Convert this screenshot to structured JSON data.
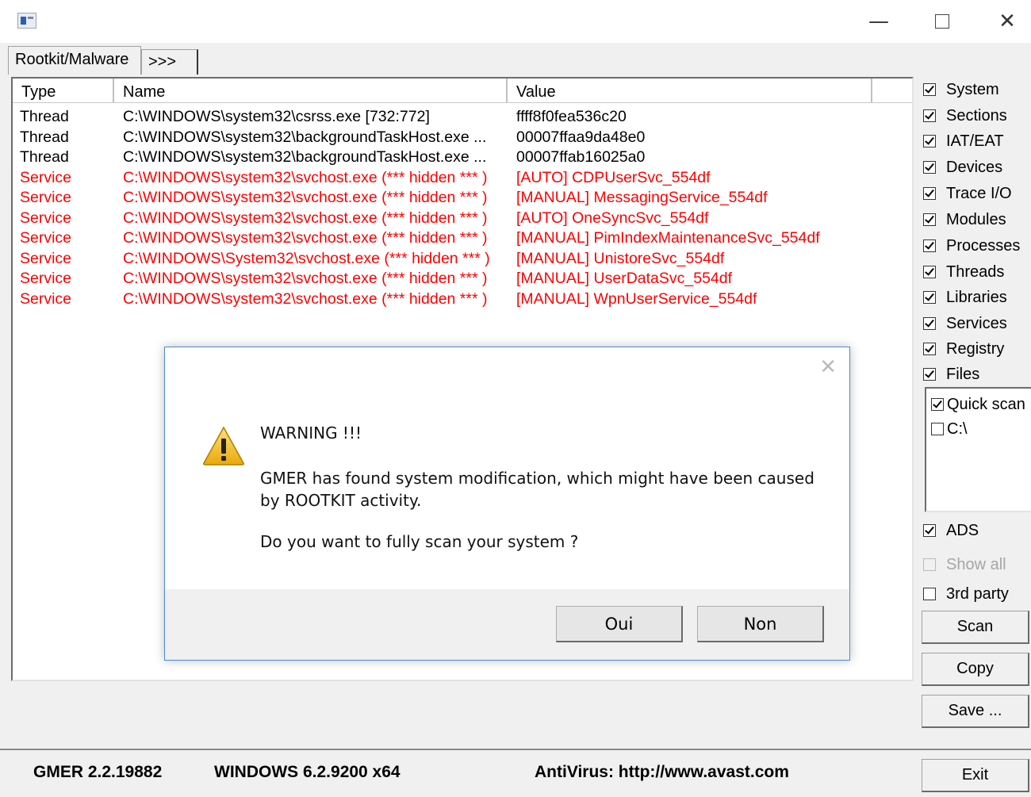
{
  "window": {
    "icon": "app-window-icon",
    "min": "—",
    "close": "✕"
  },
  "tabs": [
    {
      "label": "Rootkit/Malware"
    },
    {
      "label": ">>>"
    }
  ],
  "columns": {
    "type": "Type",
    "name": "Name",
    "value": "Value"
  },
  "rows": [
    {
      "type": "Thread",
      "name": "C:\\WINDOWS\\system32\\csrss.exe [732:772]",
      "value": "ffff8f0fea536c20",
      "kind": "thread"
    },
    {
      "type": "Thread",
      "name": "C:\\WINDOWS\\system32\\backgroundTaskHost.exe ...",
      "value": "00007ffaa9da48e0",
      "kind": "thread"
    },
    {
      "type": "Thread",
      "name": "C:\\WINDOWS\\system32\\backgroundTaskHost.exe ...",
      "value": "00007ffab16025a0",
      "kind": "thread"
    },
    {
      "type": "Service",
      "name": "C:\\WINDOWS\\system32\\svchost.exe (*** hidden *** )",
      "value": "[AUTO] CDPUserSvc_554df",
      "kind": "service"
    },
    {
      "type": "Service",
      "name": "C:\\WINDOWS\\system32\\svchost.exe (*** hidden *** )",
      "value": "[MANUAL] MessagingService_554df",
      "kind": "service"
    },
    {
      "type": "Service",
      "name": "C:\\WINDOWS\\system32\\svchost.exe (*** hidden *** )",
      "value": "[AUTO] OneSyncSvc_554df",
      "kind": "service"
    },
    {
      "type": "Service",
      "name": "C:\\WINDOWS\\system32\\svchost.exe (*** hidden *** )",
      "value": "[MANUAL] PimIndexMaintenanceSvc_554df",
      "kind": "service"
    },
    {
      "type": "Service",
      "name": "C:\\WINDOWS\\System32\\svchost.exe (*** hidden *** )",
      "value": "[MANUAL] UnistoreSvc_554df",
      "kind": "service"
    },
    {
      "type": "Service",
      "name": "C:\\WINDOWS\\system32\\svchost.exe (*** hidden *** )",
      "value": "[MANUAL] UserDataSvc_554df",
      "kind": "service"
    },
    {
      "type": "Service",
      "name": "C:\\WINDOWS\\system32\\svchost.exe (*** hidden *** )",
      "value": "[MANUAL] WpnUserService_554df",
      "kind": "service"
    }
  ],
  "options": [
    {
      "label": "System",
      "checked": true
    },
    {
      "label": "Sections",
      "checked": true
    },
    {
      "label": "IAT/EAT",
      "checked": true
    },
    {
      "label": "Devices",
      "checked": true
    },
    {
      "label": "Trace I/O",
      "checked": true
    },
    {
      "label": "Modules",
      "checked": true
    },
    {
      "label": "Processes",
      "checked": true
    },
    {
      "label": "Threads",
      "checked": true
    },
    {
      "label": "Libraries",
      "checked": true
    },
    {
      "label": "Services",
      "checked": true
    },
    {
      "label": "Registry",
      "checked": true
    },
    {
      "label": "Files",
      "checked": true
    }
  ],
  "files": [
    {
      "label": "Quick scan",
      "checked": true
    },
    {
      "label": "C:\\",
      "checked": false
    }
  ],
  "extra": {
    "ads": {
      "label": "ADS",
      "checked": true
    },
    "show_all": {
      "label": "Show all",
      "checked": false
    },
    "third_party": {
      "label": "3rd party",
      "checked": false
    }
  },
  "buttons": {
    "scan": "Scan",
    "copy": "Copy",
    "save": "Save ...",
    "exit": "Exit"
  },
  "status": {
    "version": "GMER 2.2.19882",
    "os": "WINDOWS 6.2.9200  x64",
    "antivirus": "AntiVirus: http://www.avast.com"
  },
  "dialog": {
    "title": "WARNING !!!",
    "message": "GMER has found system modification, which might have been caused by ROOTKIT activity.",
    "question": "Do you want to fully scan your system  ?",
    "yes": "Oui",
    "no": "Non",
    "close": "✕",
    "icon": "warning-icon"
  },
  "colors": {
    "service_text": "#ff0000",
    "dialog_border": "#4a8cd8",
    "warning_fill": "#f5c518"
  }
}
